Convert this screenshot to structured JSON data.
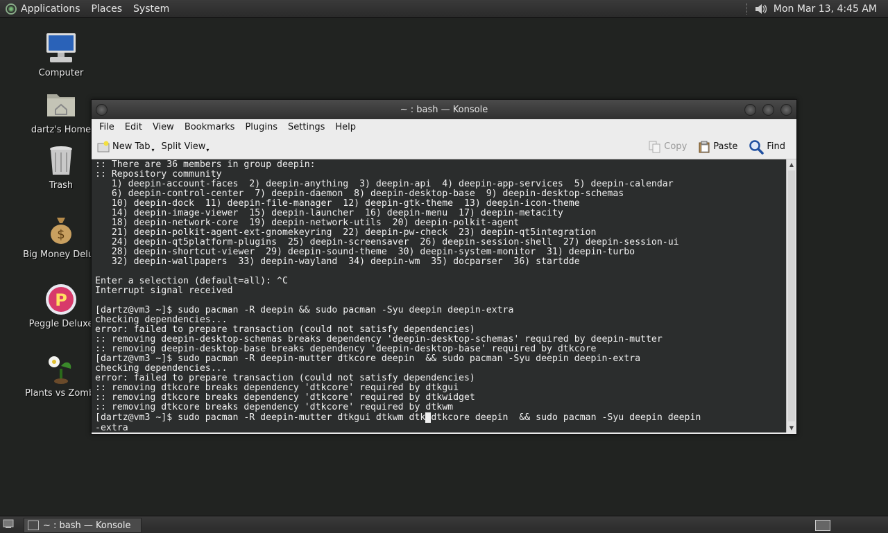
{
  "top_panel": {
    "menus": [
      "Applications",
      "Places",
      "System"
    ],
    "clock": "Mon Mar 13,  4:45 AM"
  },
  "desktop_icons": [
    {
      "label": "Computer",
      "icon": "computer-icon"
    },
    {
      "label": "dartz's Home",
      "icon": "home-folder-icon"
    },
    {
      "label": "Trash",
      "icon": "trash-icon"
    },
    {
      "label": "Big Money Delux",
      "icon": "money-bag-icon"
    },
    {
      "label": "Peggle Deluxe",
      "icon": "peggle-icon"
    },
    {
      "label": "Plants vs Zombi",
      "icon": "plant-icon"
    }
  ],
  "window": {
    "title": "~ : bash — Konsole",
    "menu": [
      "File",
      "Edit",
      "View",
      "Bookmarks",
      "Plugins",
      "Settings",
      "Help"
    ],
    "toolbar": {
      "new_tab": "New Tab",
      "split_view": "Split View",
      "copy": "Copy",
      "paste": "Paste",
      "find": "Find"
    },
    "terminal": {
      "lines": [
        ":: There are 36 members in group deepin:",
        ":: Repository community",
        "   1) deepin-account-faces  2) deepin-anything  3) deepin-api  4) deepin-app-services  5) deepin-calendar",
        "   6) deepin-control-center  7) deepin-daemon  8) deepin-desktop-base  9) deepin-desktop-schemas",
        "   10) deepin-dock  11) deepin-file-manager  12) deepin-gtk-theme  13) deepin-icon-theme",
        "   14) deepin-image-viewer  15) deepin-launcher  16) deepin-menu  17) deepin-metacity",
        "   18) deepin-network-core  19) deepin-network-utils  20) deepin-polkit-agent",
        "   21) deepin-polkit-agent-ext-gnomekeyring  22) deepin-pw-check  23) deepin-qt5integration",
        "   24) deepin-qt5platform-plugins  25) deepin-screensaver  26) deepin-session-shell  27) deepin-session-ui",
        "   28) deepin-shortcut-viewer  29) deepin-sound-theme  30) deepin-system-monitor  31) deepin-turbo",
        "   32) deepin-wallpapers  33) deepin-wayland  34) deepin-wm  35) docparser  36) startdde",
        "",
        "Enter a selection (default=all): ^C",
        "Interrupt signal received",
        "",
        "[dartz@vm3 ~]$ sudo pacman -R deepin && sudo pacman -Syu deepin deepin-extra",
        "checking dependencies...",
        "error: failed to prepare transaction (could not satisfy dependencies)",
        ":: removing deepin-desktop-schemas breaks dependency 'deepin-desktop-schemas' required by deepin-mutter",
        ":: removing deepin-desktop-base breaks dependency 'deepin-desktop-base' required by dtkcore",
        "[dartz@vm3 ~]$ sudo pacman -R deepin-mutter dtkcore deepin  && sudo pacman -Syu deepin deepin-extra",
        "checking dependencies...",
        "error: failed to prepare transaction (could not satisfy dependencies)",
        ":: removing dtkcore breaks dependency 'dtkcore' required by dtkgui",
        ":: removing dtkcore breaks dependency 'dtkcore' required by dtkwidget",
        ":: removing dtkcore breaks dependency 'dtkcore' required by dtkwm"
      ],
      "prompt_before_cursor": "[dartz@vm3 ~]$ sudo pacman -R deepin-mutter dtkgui dtkwm dtk",
      "cursor_char": " ",
      "prompt_after_cursor": "dtkcore deepin  && sudo pacman -Syu deepin deepin",
      "wrap_line": "-extra"
    }
  },
  "taskbar": {
    "task_label": "~ : bash — Konsole"
  }
}
